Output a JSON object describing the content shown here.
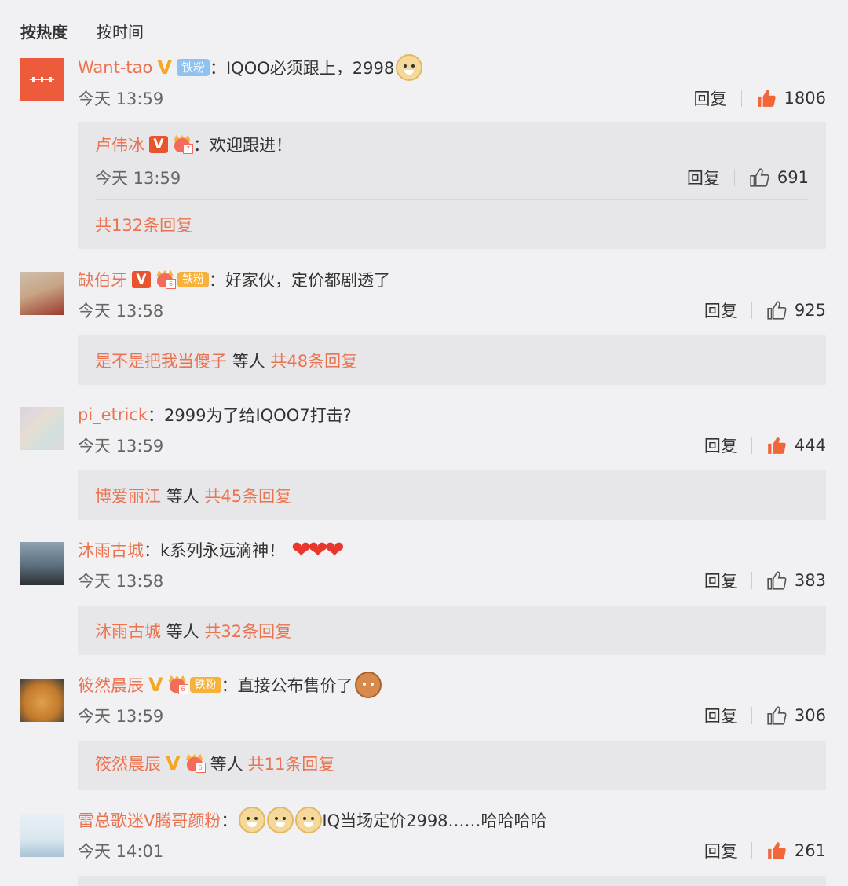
{
  "sort": {
    "active": "按热度",
    "other": "按时间"
  },
  "colors": {
    "accent": "#eb7350",
    "background": "#f1f0f2",
    "subbox": "#e7e6e9",
    "like_active": "#f2673a"
  },
  "comments": [
    {
      "user": "Want-tao",
      "fan_badge": "铁粉",
      "colon": "：",
      "text": "IQOO必须跟上，2998",
      "time": "今天 13:59",
      "reply": "回复",
      "likes": "1806",
      "liked": true,
      "sub_reply": {
        "user": "卢伟冰",
        "colon": "：",
        "text": "欢迎跟进！",
        "time": "今天 13:59",
        "reply": "回复",
        "likes": "691"
      },
      "more": "共132条回复"
    },
    {
      "user": "缺伯牙",
      "fan_badge": "铁粉",
      "colon": "：",
      "text": "好家伙，定价都剧透了",
      "time": "今天 13:58",
      "reply": "回复",
      "likes": "925",
      "liked": false,
      "sub_summary": {
        "name": "是不是把我当傻子",
        "others": "等人",
        "count": "共48条回复"
      }
    },
    {
      "user": "pi_etrick",
      "colon": "：",
      "text": "2999为了给IQOO7打击?",
      "time": "今天 13:59",
      "reply": "回复",
      "likes": "444",
      "liked": true,
      "sub_summary": {
        "name": "博爱丽江",
        "others": "等人",
        "count": "共45条回复"
      }
    },
    {
      "user": "沐雨古城",
      "colon": "：",
      "text": "k系列永远滴神！",
      "hearts": "❤❤❤",
      "time": "今天 13:58",
      "reply": "回复",
      "likes": "383",
      "liked": false,
      "sub_summary": {
        "name": "沐雨古城",
        "others": "等人",
        "count": "共32条回复"
      }
    },
    {
      "user": "筱然晨辰",
      "fan_badge": "铁粉",
      "colon": "：",
      "text": "直接公布售价了",
      "time": "今天 13:59",
      "reply": "回复",
      "likes": "306",
      "liked": false,
      "sub_summary": {
        "name": "筱然晨辰",
        "others": "等人",
        "count": "共11条回复"
      }
    },
    {
      "user": "雷总歌迷V腾哥颜粉",
      "colon": "：",
      "text": "IQ当场定价2998……哈哈哈哈",
      "time": "今天 14:01",
      "reply": "回复",
      "likes": "261",
      "liked": true
    }
  ]
}
